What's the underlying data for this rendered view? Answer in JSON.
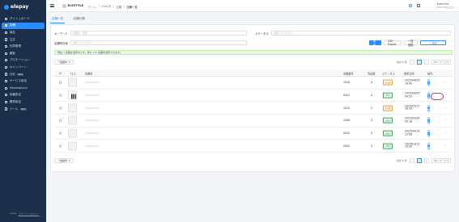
{
  "brand": {
    "name": "elepay"
  },
  "sidebar": {
    "items": [
      {
        "label": "ダッシュボード",
        "icon": "dashboard-icon",
        "active": false
      },
      {
        "label": "店舗",
        "icon": "store-icon",
        "active": true
      },
      {
        "label": "商品",
        "icon": "product-icon",
        "active": false
      },
      {
        "label": "注文",
        "icon": "order-icon",
        "active": false
      },
      {
        "label": "在庫管理",
        "icon": "inventory-icon",
        "active": false
      },
      {
        "label": "顧客",
        "icon": "customer-icon",
        "active": false
      },
      {
        "label": "プロモーション",
        "icon": "promotion-icon",
        "active": false
      },
      {
        "label": "キャンペーン",
        "icon": "campaign-icon",
        "active": false
      },
      {
        "label": "分析",
        "icon": "analytics-icon",
        "active": false,
        "badge": "BETA"
      },
      {
        "label": "サービス設定",
        "icon": "service-settings-icon",
        "active": false
      },
      {
        "label": "Marketplace",
        "icon": "marketplace-icon",
        "active": false
      },
      {
        "label": "各種設定",
        "icon": "settings-icon",
        "active": false
      },
      {
        "label": "開発設定",
        "icon": "developer-icon",
        "active": false
      },
      {
        "label": "ツール",
        "icon": "tool-icon",
        "active": false,
        "badge": "BETA"
      }
    ],
    "footer": {
      "prefix": "elepay",
      "link": "プライバシーポリシー"
    }
  },
  "topbar": {
    "shop_name": "ELESTYLE",
    "breadcrumb": [
      "ホーム",
      "OneQR",
      "店舗",
      "店舗一覧"
    ],
    "account_name": "ELESTYLE",
    "account_sub": "ELESTYLE株式会社"
  },
  "tabs": [
    {
      "label": "店舗一覧",
      "active": true
    },
    {
      "label": "店舗分類",
      "active": false
    }
  ],
  "filters": {
    "keyword_label": "キーワード",
    "keyword_placeholder": "店舗名、番号",
    "status_label": "ステータス",
    "status_placeholder": "選択してください",
    "classification_label": "店舗所在地",
    "classification_placeholder": "選択してください",
    "search_button": "検索",
    "csv_button": "CSV Export",
    "bulk_button": "一括登録",
    "add_button": "+ 追加"
  },
  "notice": {
    "prefix": "現在",
    "count": "0",
    "mid": "店舗を選択中です。残り",
    "remaining": "200",
    "suffix": "店舗を選択できます。"
  },
  "bulk_action": "一括操作",
  "pagination": {
    "total": "合計 6 件",
    "current": "1",
    "per_page": "50 / ページ"
  },
  "table": {
    "headers": [
      "ロゴ",
      "店舗名",
      "店舗番号",
      "商品数",
      "ステータス",
      "更新日時",
      "操作"
    ],
    "rows": [
      {
        "logo": "blank",
        "number": "1016",
        "products": "4",
        "status": "未公開",
        "status_type": "unp",
        "date": "2025/06/09\n16:40"
      },
      {
        "logo": "barcode",
        "number": "0001",
        "products": "4",
        "status": "公開中",
        "status_type": "pub",
        "date": "2025/06/05\n09:55"
      },
      {
        "logo": "blank",
        "number": "1010",
        "products": "2",
        "status": "未公開",
        "status_type": "unp",
        "date": "2025/05/17\n16:33"
      },
      {
        "logo": "blank",
        "number": "1006",
        "products": "4",
        "status": "公開中",
        "status_type": "pub",
        "date": "2025/05/04\n03:18"
      },
      {
        "logo": "blank",
        "number": "0002",
        "products": "4",
        "status": "公開中",
        "status_type": "pub",
        "date": "2025/04/14\n12:08"
      },
      {
        "logo": "blank",
        "number": "0003",
        "products": "4",
        "status": "公開中",
        "status_type": "pub",
        "date": "2025/03/12\n13:30"
      }
    ],
    "edit_label": "詳細",
    "more_label": "···"
  }
}
